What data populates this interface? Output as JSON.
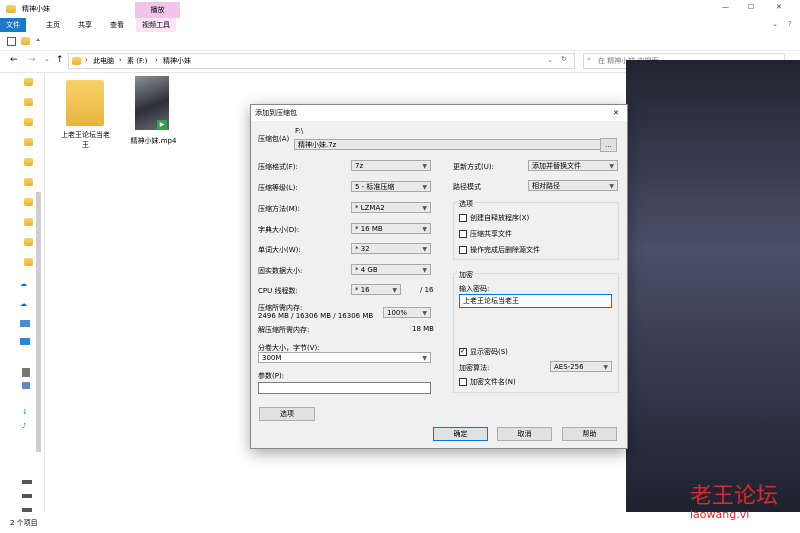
{
  "window": {
    "title": "精神小妹",
    "context_header": "播放",
    "min_btn": "—",
    "max_btn": "☐",
    "close_btn": "✕"
  },
  "ribbon": {
    "tabs": [
      "文件",
      "主页",
      "共享",
      "查看",
      "视频工具"
    ],
    "help_icon": "?"
  },
  "address": {
    "path": [
      "此电脑",
      "素 (F:)",
      "精神小妹"
    ],
    "search_placeholder": "在 精神小妹 中搜索"
  },
  "files": [
    {
      "name": "上老王论坛当老王",
      "type": "folder"
    },
    {
      "name": "精神小妹.mp4",
      "type": "video"
    }
  ],
  "status": {
    "count": "2 个项目"
  },
  "watermark": {
    "line1": "老王论坛",
    "line2": "laowang.vi"
  },
  "dialog": {
    "title": "添加到压缩包",
    "close": "✕",
    "archive_label": "压缩包(A)",
    "archive_path": "F:\\",
    "archive_name": "精神小妹.7z",
    "browse": "...",
    "format_label": "压缩格式(F):",
    "format_value": "7z",
    "level_label": "压缩等级(L):",
    "level_value": "5 - 标准压缩",
    "method_label": "压缩方法(M):",
    "method_value": "* LZMA2",
    "dict_label": "字典大小(D):",
    "dict_value": "* 16 MB",
    "word_label": "单词大小(W):",
    "word_value": "* 32",
    "solid_label": "固实数据大小:",
    "solid_value": "* 4 GB",
    "cpu_label": "CPU 线程数:",
    "cpu_value": "* 16",
    "cpu_total": "/ 16",
    "mem_comp_label": "压缩所需内存:",
    "mem_comp_detail": "2496 MB / 16306 MB / 16306 MB",
    "mem_comp_pct": "100%",
    "mem_decomp_label": "解压缩所需内存:",
    "mem_decomp_value": "18 MB",
    "split_label": "分卷大小，字节(V):",
    "split_value": "300M",
    "params_label": "参数(P):",
    "params_value": "",
    "options_btn": "选项",
    "update_label": "更新方式(U):",
    "update_value": "添加并替换文件",
    "pathmode_label": "路径模式",
    "pathmode_value": "相对路径",
    "options_group": "选项",
    "opt_sfx": "创建自释放程序(X)",
    "opt_shared": "压缩共享文件",
    "opt_delete": "操作完成后删除源文件",
    "enc_group": "加密",
    "pwd_label": "输入密码:",
    "pwd_value": "上老王论坛当老王",
    "show_pwd": "显示密码(S)",
    "enc_method_label": "加密算法:",
    "enc_method_value": "AES-256",
    "enc_names": "加密文件名(N)",
    "ok": "确定",
    "cancel": "取消",
    "help": "帮助"
  }
}
